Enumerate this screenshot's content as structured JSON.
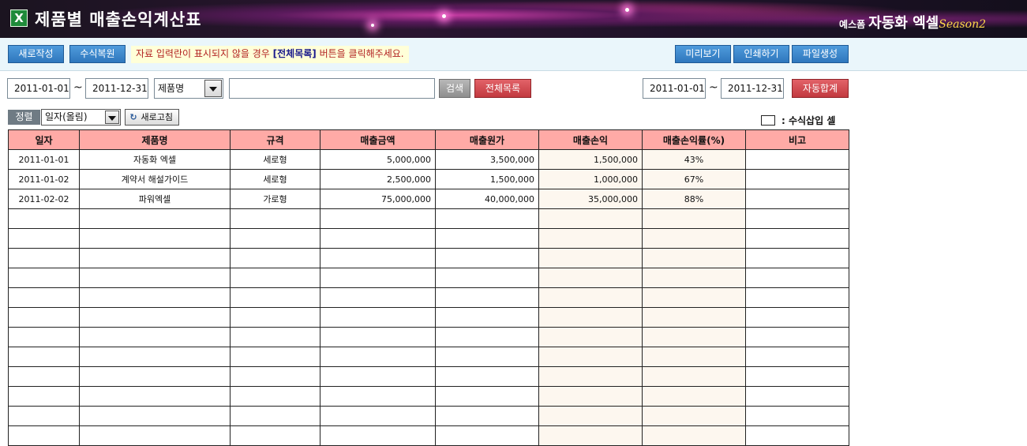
{
  "app": {
    "title": "제품별 매출손익계산표",
    "icon": "excel-icon",
    "brand_prefix": "예스폼",
    "brand_name": "자동화 엑셀",
    "brand_season": "Season2"
  },
  "toolbar": {
    "new_label": "새로작성",
    "restore_label": "수식복원",
    "notice_pre": "자료 입력란이 표시되지  않을 경우 ",
    "notice_highlight": "[전체목록]",
    "notice_post": " 버튼을 클릭해주세요.",
    "preview_label": "미리보기",
    "print_label": "인쇄하기",
    "file_label": "파일생성"
  },
  "search": {
    "date_from": "2011-01-01",
    "tilde": "~",
    "date_to": "2011-12-31",
    "field_selected": "제품명",
    "keyword": "",
    "search_label": "검색",
    "all_label": "전체목록",
    "sum_date_from": "2011-01-01",
    "sum_date_to": "2011-12-31",
    "auto_sum_label": "자동합계"
  },
  "sort": {
    "label": "정렬",
    "selected": "일자(올림)",
    "refresh_label": "새로고침"
  },
  "legend": {
    "text": ": 수식삽입 셀"
  },
  "table": {
    "headers": [
      "일자",
      "제품명",
      "규격",
      "매출금액",
      "매출원가",
      "매출손익",
      "매출손익률(%)",
      "비고"
    ],
    "rows": [
      [
        "2011-01-01",
        "자동화 엑셀",
        "세로형",
        "5,000,000",
        "3,500,000",
        "1,500,000",
        "43%",
        ""
      ],
      [
        "2011-01-02",
        "계약서 해설가이드",
        "세로형",
        "2,500,000",
        "1,500,000",
        "1,000,000",
        "67%",
        ""
      ],
      [
        "2011-02-02",
        "파워엑셀",
        "가로형",
        "75,000,000",
        "40,000,000",
        "35,000,000",
        "88%",
        ""
      ]
    ],
    "empty_rows": 12
  },
  "colors": {
    "header_bg": "#ffaaa6",
    "formula_cell_bg": "#fdf7ef",
    "button_blue": "#3a86cc",
    "button_red": "#cf4a50"
  }
}
